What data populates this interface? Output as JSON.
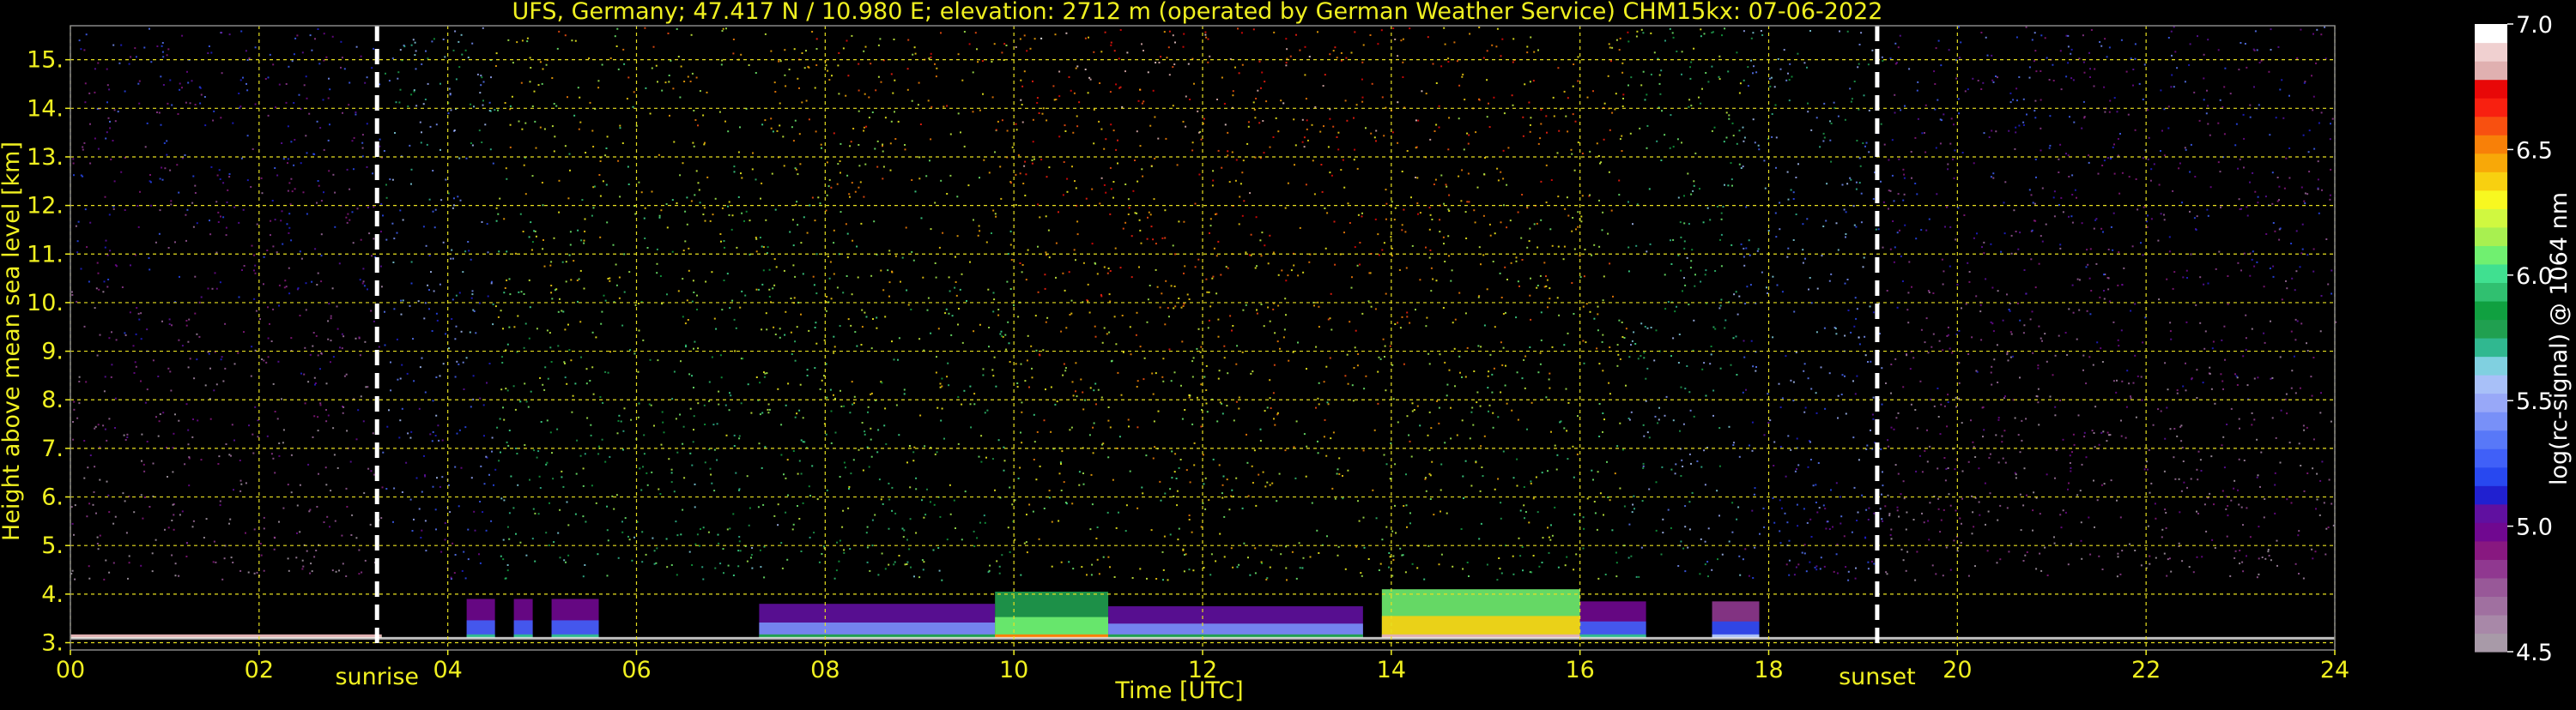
{
  "chart_data": {
    "type": "heatmap",
    "title": "UFS, Germany; 47.417 N / 10.980 E; elevation: 2712 m  (operated by German Weather Service)    CHM15kx: 07-06-2022",
    "xlabel": "Time [UTC]",
    "ylabel": "Height above mean sea level [km]",
    "xlim": [
      0,
      24
    ],
    "ylim": [
      2.85,
      15.7
    ],
    "x_ticks": [
      "00",
      "02",
      "04",
      "06",
      "08",
      "10",
      "12",
      "14",
      "16",
      "18",
      "20",
      "22",
      "24"
    ],
    "y_ticks": [
      "3.",
      "4.",
      "5.",
      "6.",
      "7.",
      "8.",
      "9.",
      "10.",
      "11.",
      "12.",
      "13.",
      "14.",
      "15."
    ],
    "grid": true,
    "events": [
      {
        "label": "sunrise",
        "time": 3.25
      },
      {
        "label": "sunset",
        "time": 19.15
      }
    ],
    "colorbar": {
      "label": "log(rc-signal) @ 1064 nm",
      "range": [
        4.5,
        7.0
      ],
      "ticks": [
        "4.5",
        "5.0",
        "5.5",
        "6.0",
        "6.5",
        "7.0"
      ],
      "colors": [
        "#a89aa8",
        "#a888a8",
        "#a070a0",
        "#985898",
        "#903890",
        "#881880",
        "#700890",
        "#6010a0",
        "#2020d0",
        "#2848f0",
        "#4060f8",
        "#5878f8",
        "#7890f8",
        "#98a8f8",
        "#a8c0f8",
        "#80d0e0",
        "#30b890",
        "#20a050",
        "#10a040",
        "#30c070",
        "#40e090",
        "#70f070",
        "#a8f050",
        "#d0f840",
        "#f8f820",
        "#f8d010",
        "#f8a808",
        "#f88008",
        "#f85010",
        "#f82010",
        "#e80808",
        "#e0b0b0",
        "#f0d0d0",
        "#ffffff"
      ]
    },
    "layers": [
      {
        "start": 0.0,
        "end": 3.3,
        "top": 3.15,
        "level": 6.4
      },
      {
        "start": 4.2,
        "end": 4.5,
        "top": 3.9,
        "level": 5.3
      },
      {
        "start": 4.7,
        "end": 4.9,
        "top": 3.9,
        "level": 5.3
      },
      {
        "start": 5.1,
        "end": 5.6,
        "top": 3.9,
        "level": 5.3
      },
      {
        "start": 7.3,
        "end": 9.8,
        "top": 3.8,
        "level": 5.4
      },
      {
        "start": 9.8,
        "end": 11.0,
        "top": 4.05,
        "level": 6.1
      },
      {
        "start": 11.0,
        "end": 13.7,
        "top": 3.75,
        "level": 5.4
      },
      {
        "start": 13.9,
        "end": 16.0,
        "top": 4.1,
        "level": 6.4
      },
      {
        "start": 16.0,
        "end": 16.7,
        "top": 3.85,
        "level": 5.3
      },
      {
        "start": 17.4,
        "end": 17.9,
        "top": 3.85,
        "level": 5.2
      }
    ],
    "noise_bands": [
      {
        "start": 0.0,
        "end": 3.3,
        "level": 5.1
      },
      {
        "start": 3.3,
        "end": 4.5,
        "level": 5.6
      },
      {
        "start": 4.5,
        "end": 7.5,
        "level": 6.3
      },
      {
        "start": 7.5,
        "end": 10.0,
        "level": 6.4
      },
      {
        "start": 10.0,
        "end": 14.5,
        "level": 6.6
      },
      {
        "start": 14.5,
        "end": 16.5,
        "level": 6.5
      },
      {
        "start": 16.5,
        "end": 17.7,
        "level": 6.0
      },
      {
        "start": 17.7,
        "end": 19.2,
        "level": 5.6
      },
      {
        "start": 19.2,
        "end": 24.0,
        "level": 5.1
      }
    ]
  }
}
